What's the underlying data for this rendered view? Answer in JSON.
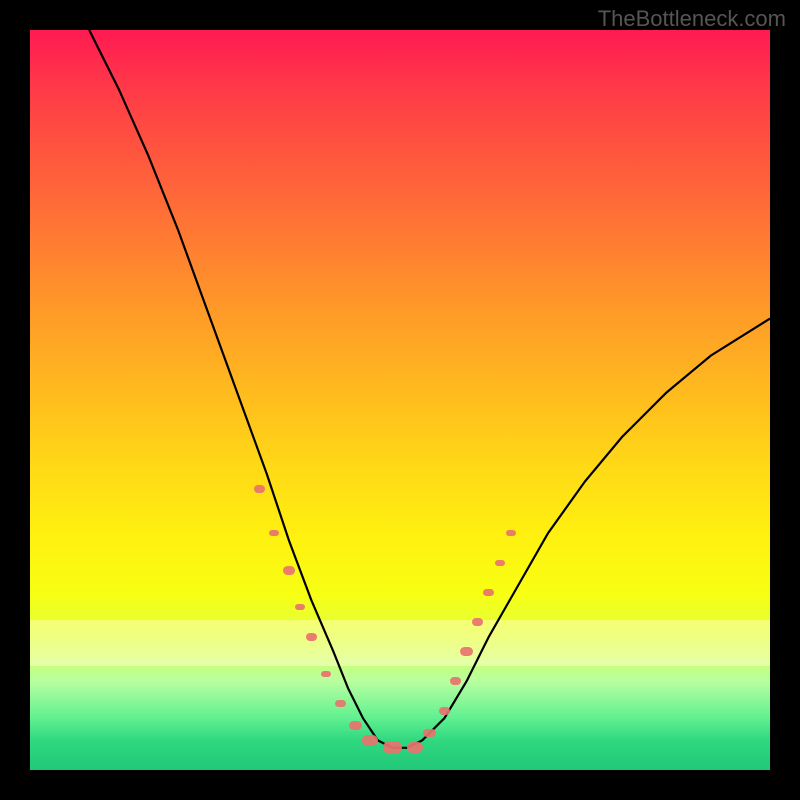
{
  "watermark": "TheBottleneck.com",
  "chart_data": {
    "type": "line",
    "title": "",
    "xlabel": "",
    "ylabel": "",
    "xlim": [
      0,
      100
    ],
    "ylim": [
      0,
      100
    ],
    "grid": false,
    "legend": false,
    "series": [
      {
        "name": "bottleneck-curve",
        "x": [
          8,
          12,
          16,
          20,
          24,
          28,
          32,
          35,
          38,
          41,
          43,
          45,
          47,
          49,
          51,
          53,
          56,
          59,
          62,
          66,
          70,
          75,
          80,
          86,
          92,
          100
        ],
        "y": [
          100,
          92,
          83,
          73,
          62,
          51,
          40,
          31,
          23,
          16,
          11,
          7,
          4,
          3,
          3,
          4,
          7,
          12,
          18,
          25,
          32,
          39,
          45,
          51,
          56,
          61
        ]
      }
    ],
    "markers": [
      {
        "x": 31,
        "y": 38,
        "r": 7
      },
      {
        "x": 33,
        "y": 32,
        "r": 6
      },
      {
        "x": 35,
        "y": 27,
        "r": 8
      },
      {
        "x": 36.5,
        "y": 22,
        "r": 6
      },
      {
        "x": 38,
        "y": 18,
        "r": 7
      },
      {
        "x": 40,
        "y": 13,
        "r": 6
      },
      {
        "x": 42,
        "y": 9,
        "r": 7
      },
      {
        "x": 44,
        "y": 6,
        "r": 8
      },
      {
        "x": 46,
        "y": 4,
        "r": 10
      },
      {
        "x": 49,
        "y": 3,
        "r": 12
      },
      {
        "x": 52,
        "y": 3,
        "r": 10
      },
      {
        "x": 54,
        "y": 5,
        "r": 8
      },
      {
        "x": 56,
        "y": 8,
        "r": 7
      },
      {
        "x": 57.5,
        "y": 12,
        "r": 7
      },
      {
        "x": 59,
        "y": 16,
        "r": 8
      },
      {
        "x": 60.5,
        "y": 20,
        "r": 7
      },
      {
        "x": 62,
        "y": 24,
        "r": 7
      },
      {
        "x": 63.5,
        "y": 28,
        "r": 6
      },
      {
        "x": 65,
        "y": 32,
        "r": 6
      }
    ],
    "background_gradient": {
      "top": "#ff1a52",
      "mid": "#fff010",
      "bottom": "#20c878"
    }
  }
}
